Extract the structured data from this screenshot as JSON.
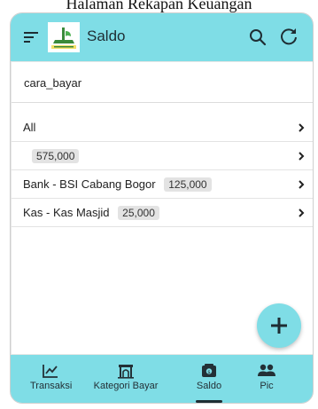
{
  "page_heading": "Halaman Rekapan Keuangan",
  "app_bar": {
    "title": "Saldo",
    "icons": [
      "menu-icon",
      "logo",
      "search-icon",
      "refresh-icon"
    ]
  },
  "filter": {
    "label": "cara_bayar"
  },
  "rows": [
    {
      "label": "All",
      "amount": ""
    },
    {
      "label": "",
      "amount": "575,000"
    },
    {
      "label": "Bank - BSI Cabang Bogor",
      "amount": "125,000"
    },
    {
      "label": "Kas - Kas Masjid",
      "amount": "25,000"
    }
  ],
  "bottom_nav": {
    "active": "Saldo",
    "items": [
      {
        "label": "Transaksi",
        "icon": "chart-icon"
      },
      {
        "label": "Kategori Bayar",
        "icon": "mosque-icon"
      },
      {
        "label": "Saldo",
        "icon": "wallet-icon"
      },
      {
        "label": "Pic",
        "icon": "people-icon"
      }
    ]
  },
  "colors": {
    "accent": "#7fdde6",
    "badge_bg": "#e3e3e3"
  }
}
